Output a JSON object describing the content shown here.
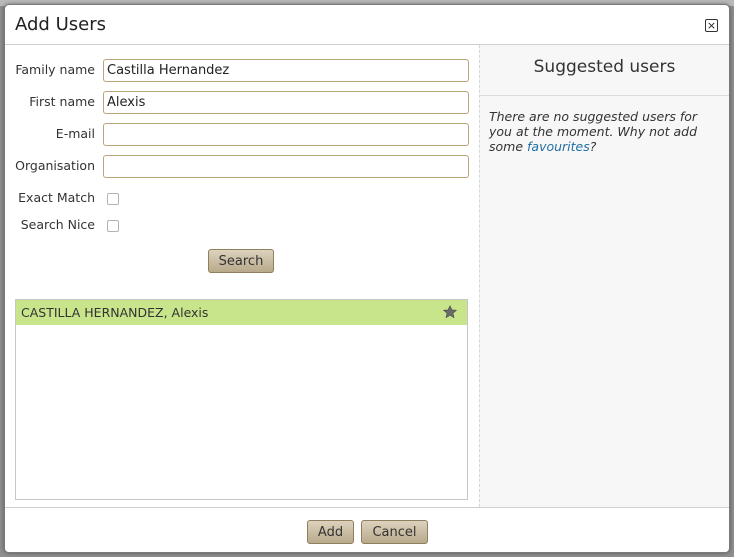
{
  "dialog": {
    "title": "Add Users",
    "close_label": "×"
  },
  "form": {
    "family_name": {
      "label": "Family name",
      "value": "Castilla Hernandez"
    },
    "first_name": {
      "label": "First name",
      "value": "Alexis"
    },
    "email": {
      "label": "E-mail",
      "value": ""
    },
    "organisation": {
      "label": "Organisation",
      "value": ""
    },
    "exact_match": {
      "label": "Exact Match",
      "checked": false
    },
    "search_nice": {
      "label": "Search Nice",
      "checked": false
    },
    "search_button": "Search"
  },
  "results": [
    {
      "name": "CASTILLA HERNANDEZ, Alexis",
      "icon": "star-icon"
    }
  ],
  "suggested": {
    "title": "Suggested users",
    "text_before": "There are no suggested users for you at the moment. Why not add some ",
    "link_text": "favourites",
    "text_after": "?"
  },
  "footer": {
    "add_label": "Add",
    "cancel_label": "Cancel"
  },
  "colors": {
    "result_highlight": "#c9e58c",
    "button_bg": "#c8bb9e",
    "input_border": "#b9a57a",
    "link": "#1f6fa6"
  }
}
